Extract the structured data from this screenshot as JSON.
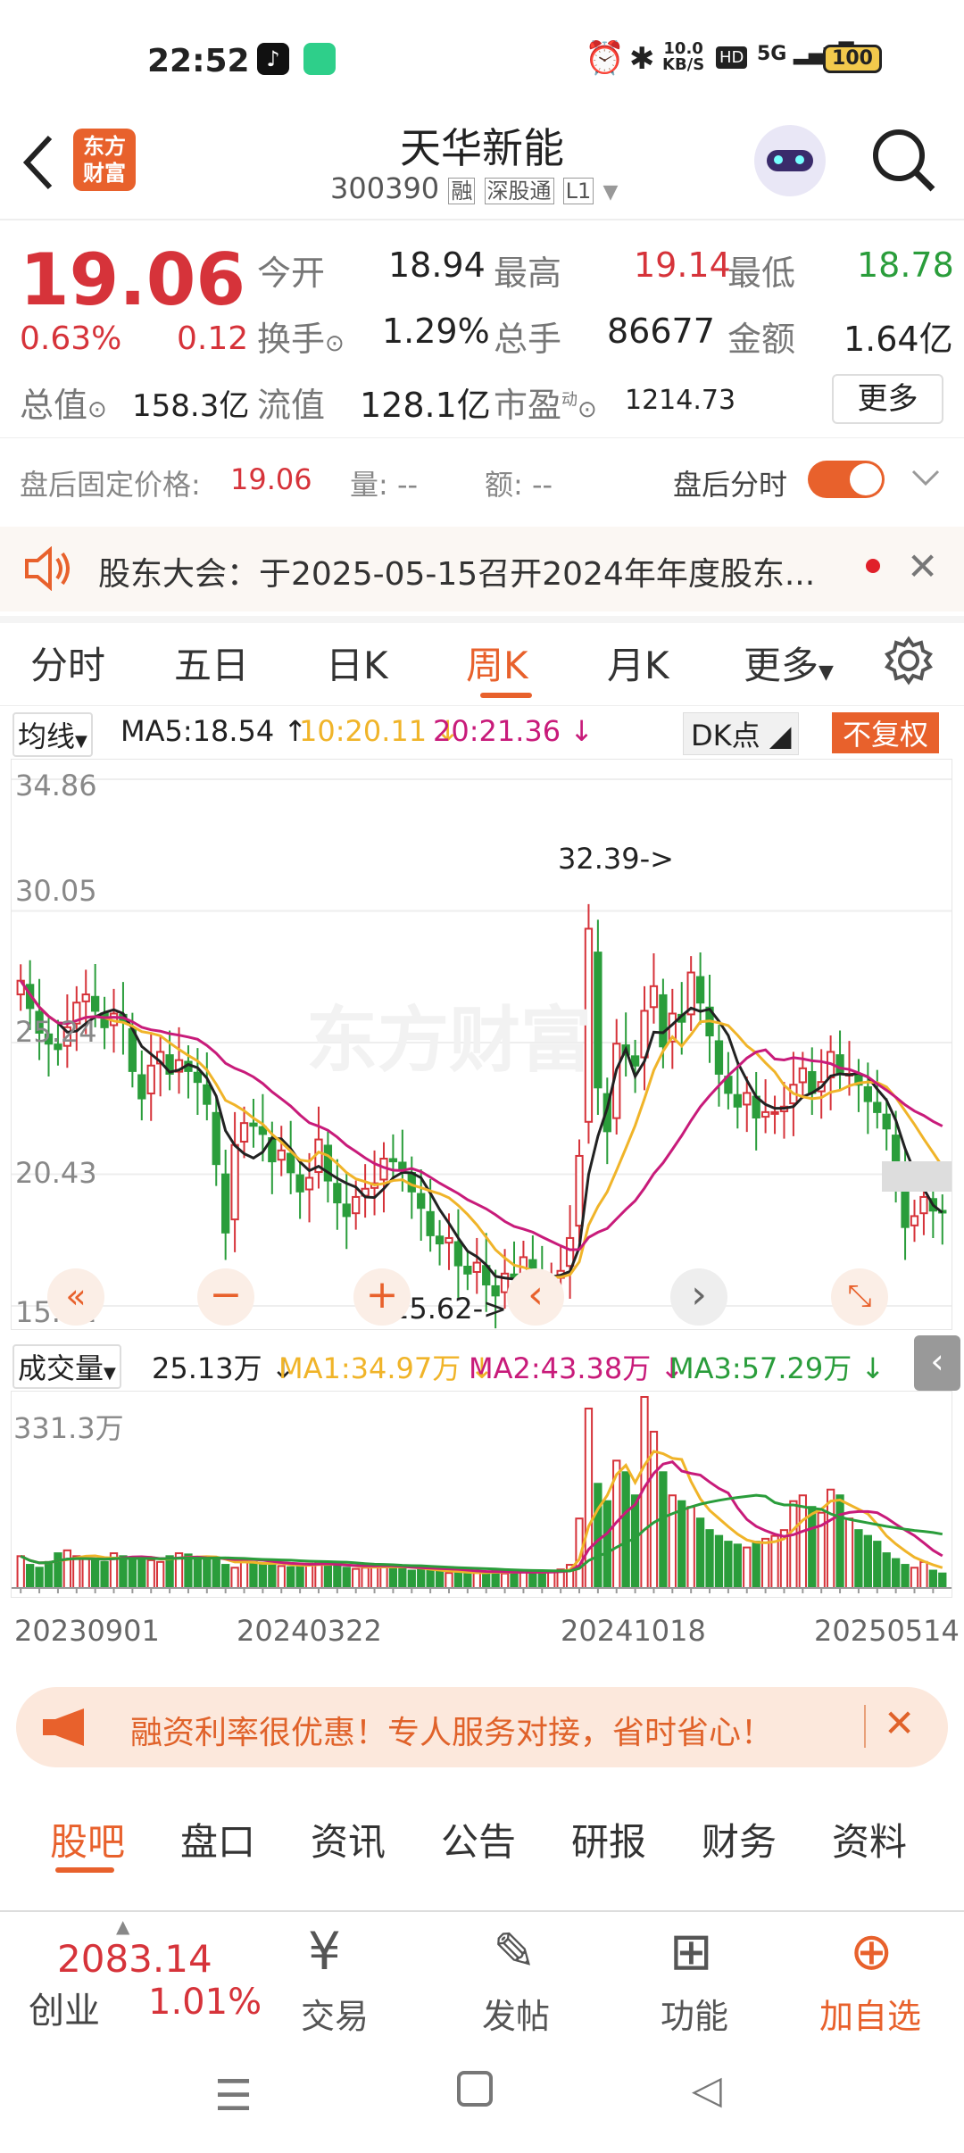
{
  "status": {
    "time": "22:52",
    "net_speed": "10.0",
    "net_unit": "KB/S",
    "hd": "HD",
    "signal": "5G",
    "battery": "100"
  },
  "header": {
    "logo_top": "东方",
    "logo_bottom": "财富",
    "stock_name": "天华新能",
    "stock_code": "300390",
    "tags": [
      "融",
      "深股通",
      "L1"
    ]
  },
  "quote": {
    "price": "19.06",
    "change_pct": "0.63%",
    "change_amt": "0.12",
    "open_label": "今开",
    "open": "18.94",
    "high_label": "最高",
    "high": "19.14",
    "low_label": "最低",
    "low": "18.78",
    "turnover_label": "换手",
    "turnover": "1.29%",
    "volume_label": "总手",
    "volume": "86677",
    "amount_label": "金额",
    "amount": "1.64亿",
    "mktcap_label": "总值",
    "mktcap": "158.3亿",
    "float_label": "流值",
    "float": "128.1亿",
    "pe_label": "市盈",
    "pe_sup": "动",
    "pe": "1214.73",
    "more": "更多"
  },
  "afterhours": {
    "price_label": "盘后固定价格:",
    "price": "19.06",
    "vol_label": "量: --",
    "amt_label": "额: --",
    "toggle_label": "盘后分时"
  },
  "notice": {
    "text": "股东大会：于2025-05-15召开2024年年度股东..."
  },
  "chart_tabs": [
    "分时",
    "五日",
    "日K",
    "周K",
    "月K",
    "更多"
  ],
  "active_tab": "周K",
  "ma": {
    "selector": "均线",
    "ma5": "MA5:18.54",
    "ma10": "10:20.11",
    "ma20": "20:21.36",
    "dk": "DK点",
    "adjust": "不复权"
  },
  "price_axis": [
    "34.86",
    "30.05",
    "25.24",
    "20.43",
    "15.62"
  ],
  "annotations": {
    "high": "32.39->",
    "low": "15.62->"
  },
  "watermark": "东方财富",
  "volume": {
    "selector": "成交量",
    "current": "25.13万",
    "ma1": "MA1:34.97万",
    "ma2": "MA2:43.38万",
    "ma3": "MA3:57.29万",
    "max": "331.3万",
    "dates": [
      "20230901",
      "20240322",
      "20241018",
      "20250514"
    ]
  },
  "promo": {
    "text": "融资利率很优惠！专人服务对接，省时省心！"
  },
  "bottom_tabs": [
    "股吧",
    "盘口",
    "资讯",
    "公告",
    "研报",
    "财务",
    "资料"
  ],
  "bottom_active": "股吧",
  "bottombar": {
    "index_value": "2083.14",
    "index_name": "创业",
    "index_pct": "1.01%",
    "trade": "交易",
    "post": "发帖",
    "func": "功能",
    "add": "加自选"
  },
  "colors": {
    "up": "#d6333a",
    "down": "#2a9d3b",
    "accent": "#e8612c",
    "ma5": "#222222",
    "ma10": "#f0b429",
    "ma20": "#c81b7a"
  },
  "chart_data": {
    "type": "candlestick",
    "period": "weekly",
    "ylim": [
      15.62,
      34.86
    ],
    "y_ticks": [
      34.86,
      30.05,
      25.24,
      20.43,
      15.62
    ],
    "x_labels": [
      "20230901",
      "20240322",
      "20241018",
      "20250514"
    ],
    "closes": [
      27.5,
      26.5,
      25.6,
      25.2,
      25.0,
      25.8,
      26.7,
      27.0,
      26.4,
      25.8,
      26.3,
      26.0,
      24.2,
      23.2,
      24.4,
      24.9,
      24.1,
      24.6,
      24.2,
      23.8,
      23.0,
      20.8,
      18.3,
      21.5,
      22.3,
      22.2,
      21.9,
      20.9,
      21.3,
      20.5,
      19.8,
      20.3,
      21.7,
      20.2,
      19.4,
      18.9,
      19.6,
      19.9,
      20.1,
      21.0,
      20.9,
      20.6,
      19.8,
      19.2,
      18.2,
      17.9,
      18.1,
      17.1,
      16.8,
      17.2,
      16.4,
      16.0,
      16.8,
      16.6,
      17.4,
      16.7,
      16.1,
      16.6,
      16.9,
      18.1,
      21.1,
      29.4,
      23.6,
      22.0,
      25.2,
      24.8,
      24.4,
      26.4,
      27.3,
      25.1,
      26.3,
      26.0,
      27.8,
      26.7,
      25.5,
      24.1,
      23.4,
      22.9,
      23.4,
      22.5,
      22.7,
      22.7,
      22.9,
      23.7,
      24.3,
      23.4,
      23.8,
      24.9,
      24.1,
      24.1,
      23.7,
      23.1,
      22.7,
      22.1,
      20.4,
      18.5,
      18.9,
      19.6,
      19.1,
      19.06
    ],
    "volumes": [
      55,
      40,
      35,
      45,
      60,
      65,
      55,
      50,
      48,
      45,
      60,
      55,
      52,
      50,
      48,
      45,
      55,
      60,
      58,
      50,
      48,
      52,
      40,
      35,
      50,
      45,
      42,
      40,
      38,
      36,
      40,
      42,
      45,
      40,
      38,
      35,
      33,
      35,
      38,
      40,
      36,
      34,
      30,
      32,
      30,
      28,
      26,
      27,
      25,
      26,
      28,
      30,
      25,
      27,
      29,
      28,
      26,
      30,
      32,
      40,
      120,
      310,
      180,
      150,
      220,
      200,
      160,
      330,
      270,
      200,
      160,
      150,
      140,
      120,
      100,
      90,
      80,
      75,
      70,
      80,
      85,
      90,
      100,
      150,
      160,
      140,
      130,
      170,
      160,
      120,
      100,
      90,
      80,
      60,
      50,
      40,
      35,
      45,
      30,
      25.13
    ],
    "ma_labels": {
      "MA5": 18.54,
      "MA10": 20.11,
      "MA20": 21.36
    },
    "volume_ma": {
      "MA1": "34.97万",
      "MA2": "43.38万",
      "MA3": "57.29万"
    }
  }
}
